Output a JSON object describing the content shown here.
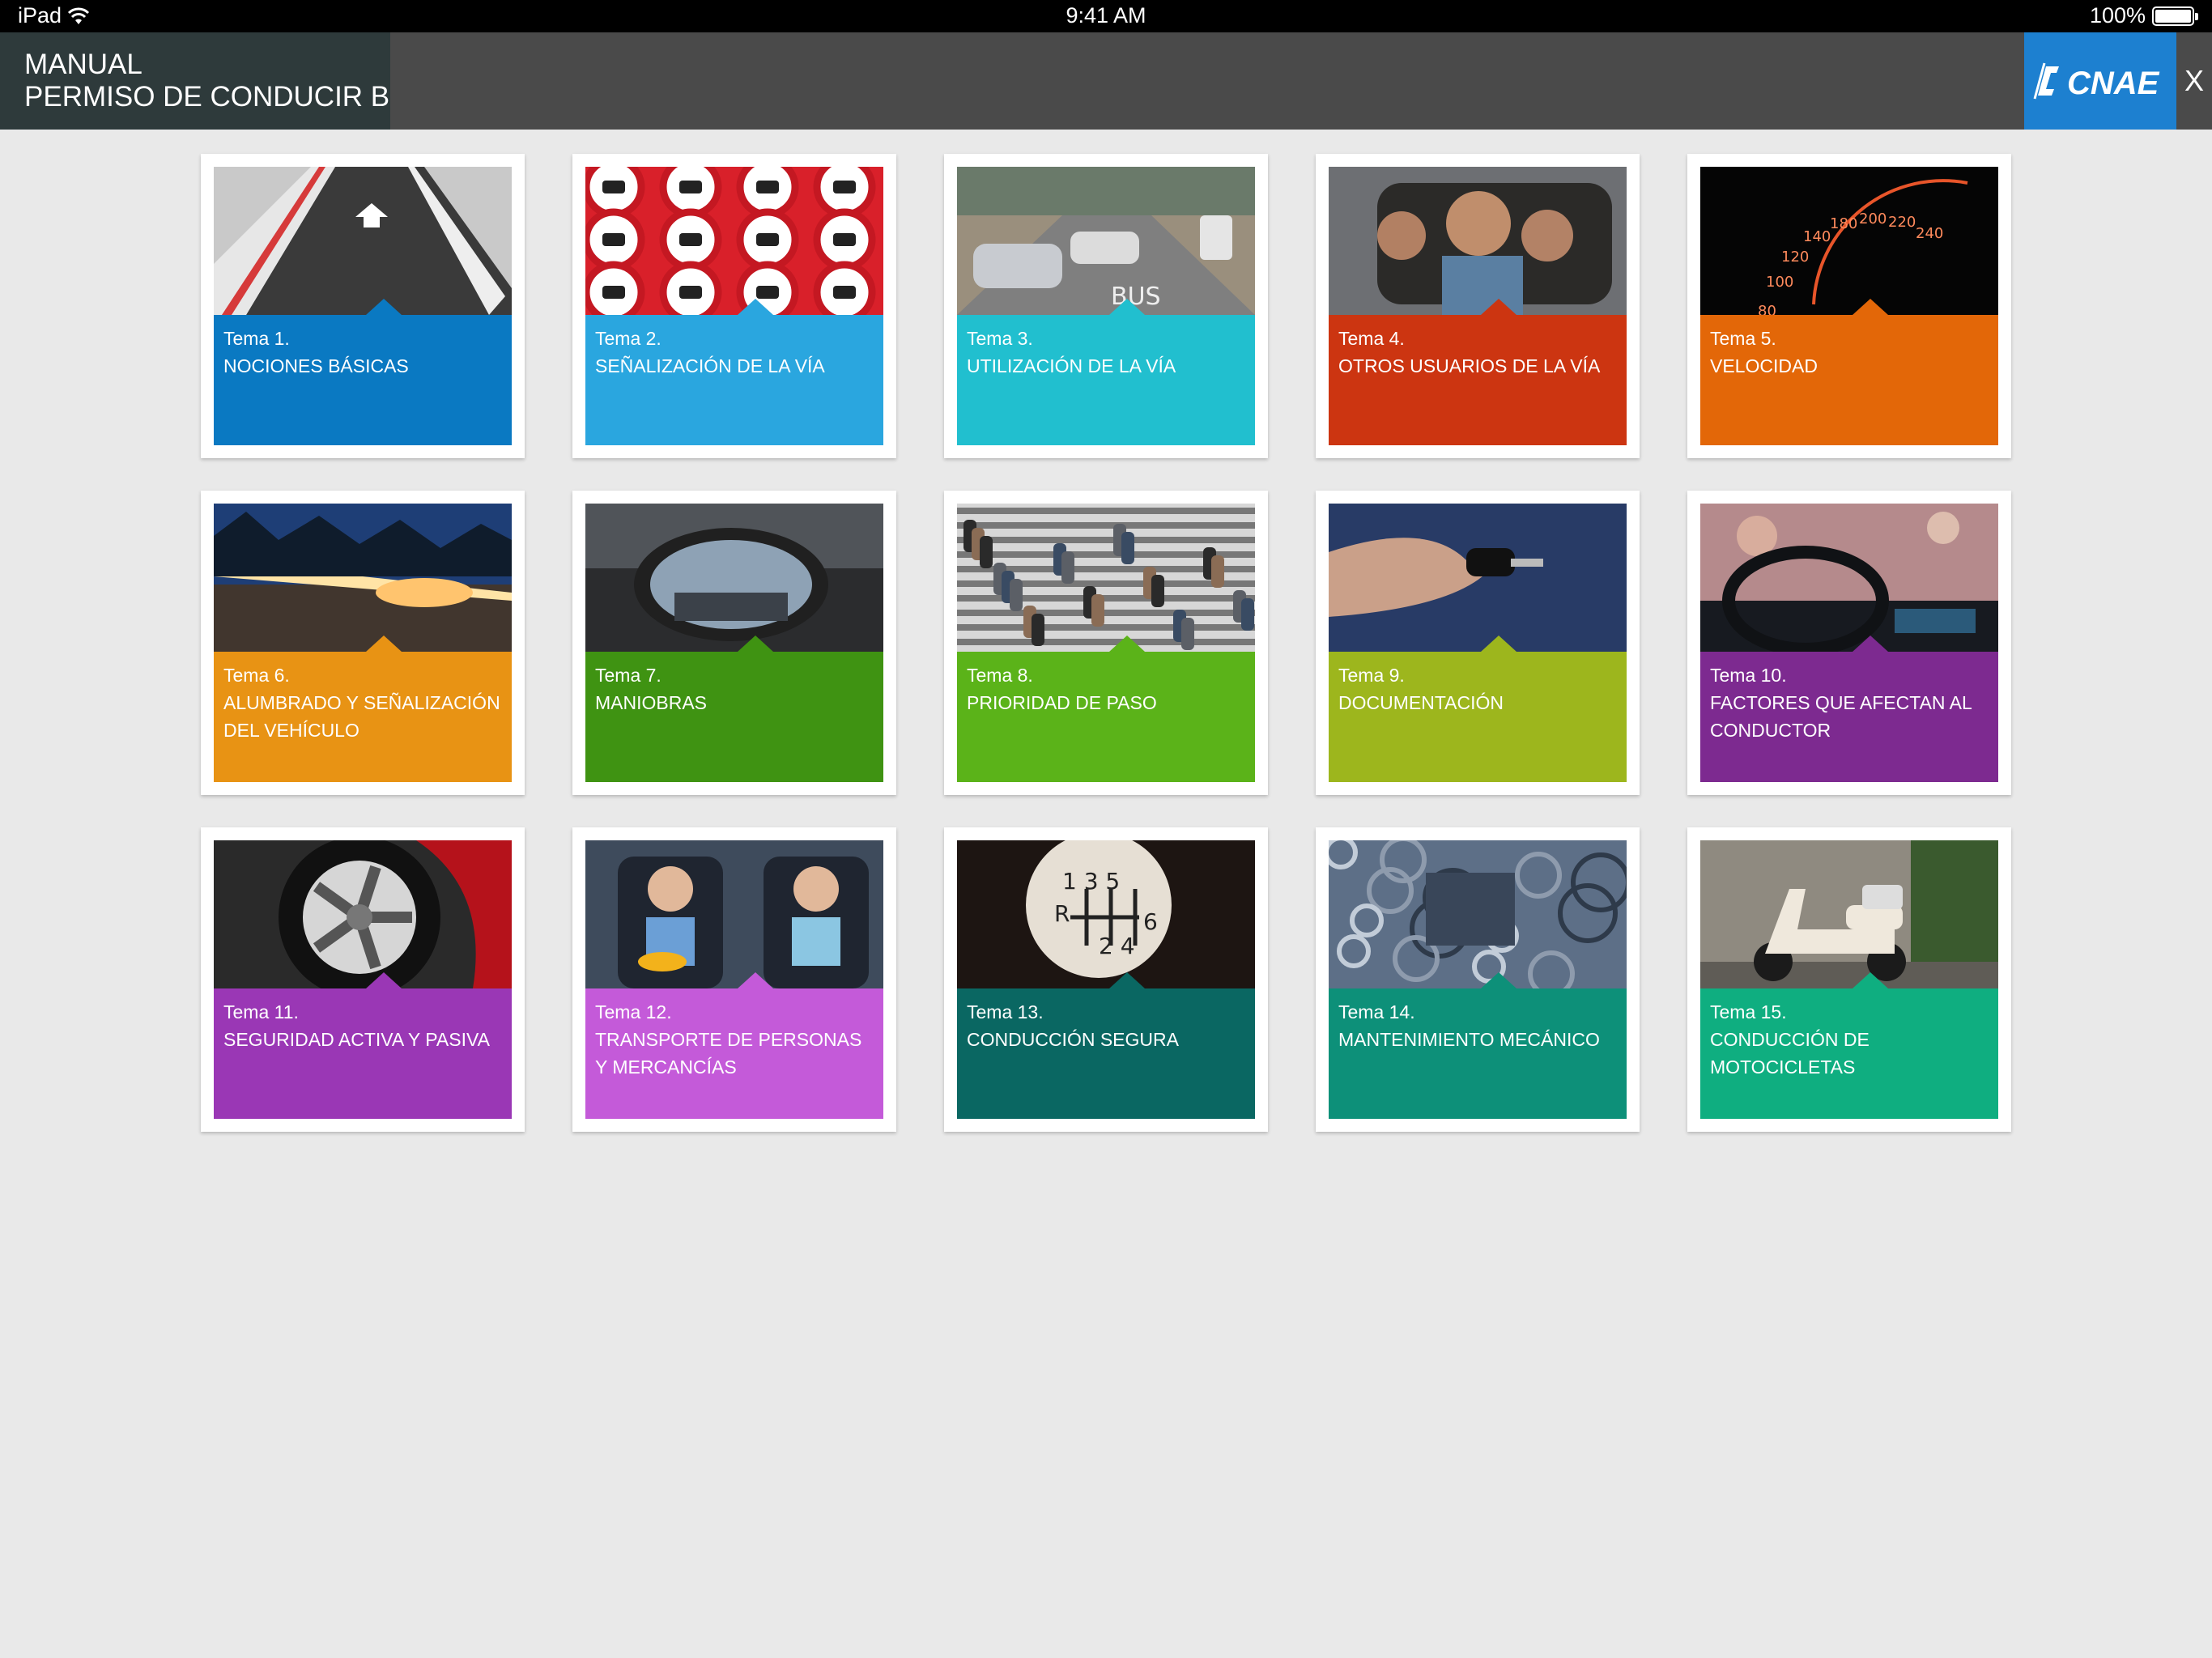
{
  "status_bar": {
    "device": "iPad",
    "time": "9:41 AM",
    "battery": "100%"
  },
  "header": {
    "title_line1": "MANUAL",
    "title_line2": "PERMISO DE CONDUCIR B",
    "logo_text": "CNAE",
    "close_label": "X"
  },
  "topics": [
    {
      "label": "Tema 1.",
      "name": "NOCIONES BÁSICAS",
      "color": "#0a79c2",
      "image": "road-arrow"
    },
    {
      "label": "Tema 2.",
      "name": "SEÑALIZACIÓN DE LA VÍA",
      "color": "#2aa6df",
      "image": "traffic-signs"
    },
    {
      "label": "Tema 3.",
      "name": "UTILIZACIÓN DE LA VÍA",
      "color": "#21bfcf",
      "image": "street-cars"
    },
    {
      "label": "Tema 4.",
      "name": "OTROS USUARIOS DE LA VÍA",
      "color": "#cc3511",
      "image": "people-in-car"
    },
    {
      "label": "Tema 5.",
      "name": "VELOCIDAD",
      "color": "#e36708",
      "image": "speedometer"
    },
    {
      "label": "Tema 6.",
      "name": "ALUMBRADO Y SEÑALIZACIÓN DEL VEHÍCULO",
      "color": "#e89314",
      "image": "light-trails"
    },
    {
      "label": "Tema 7.",
      "name": "MANIOBRAS",
      "color": "#3f9312",
      "image": "side-mirror"
    },
    {
      "label": "Tema 8.",
      "name": "PRIORIDAD DE PASO",
      "color": "#5bb319",
      "image": "crosswalk-crowd"
    },
    {
      "label": "Tema 9.",
      "name": "DOCUMENTACIÓN",
      "color": "#9db61d",
      "image": "car-key"
    },
    {
      "label": "Tema 10.",
      "name": "FACTORES QUE AFECTAN AL CONDUCTOR",
      "color": "#7d2a90",
      "image": "steering-wheel"
    },
    {
      "label": "Tema 11.",
      "name": "SEGURIDAD ACTIVA Y PASIVA",
      "color": "#9a37b5",
      "image": "wheel-rim"
    },
    {
      "label": "Tema 12.",
      "name": "TRANSPORTE DE PERSONAS Y MERCANCÍAS",
      "color": "#c45ad9",
      "image": "children-car-seats"
    },
    {
      "label": "Tema 13.",
      "name": "CONDUCCIÓN SEGURA",
      "color": "#0a6762",
      "image": "gear-knob"
    },
    {
      "label": "Tema 14.",
      "name": "MANTENIMIENTO MECÁNICO",
      "color": "#0d9079",
      "image": "engine"
    },
    {
      "label": "Tema 15.",
      "name": "CONDUCCIÓN DE MOTOCICLETAS",
      "color": "#0fae80",
      "image": "scooter"
    }
  ]
}
